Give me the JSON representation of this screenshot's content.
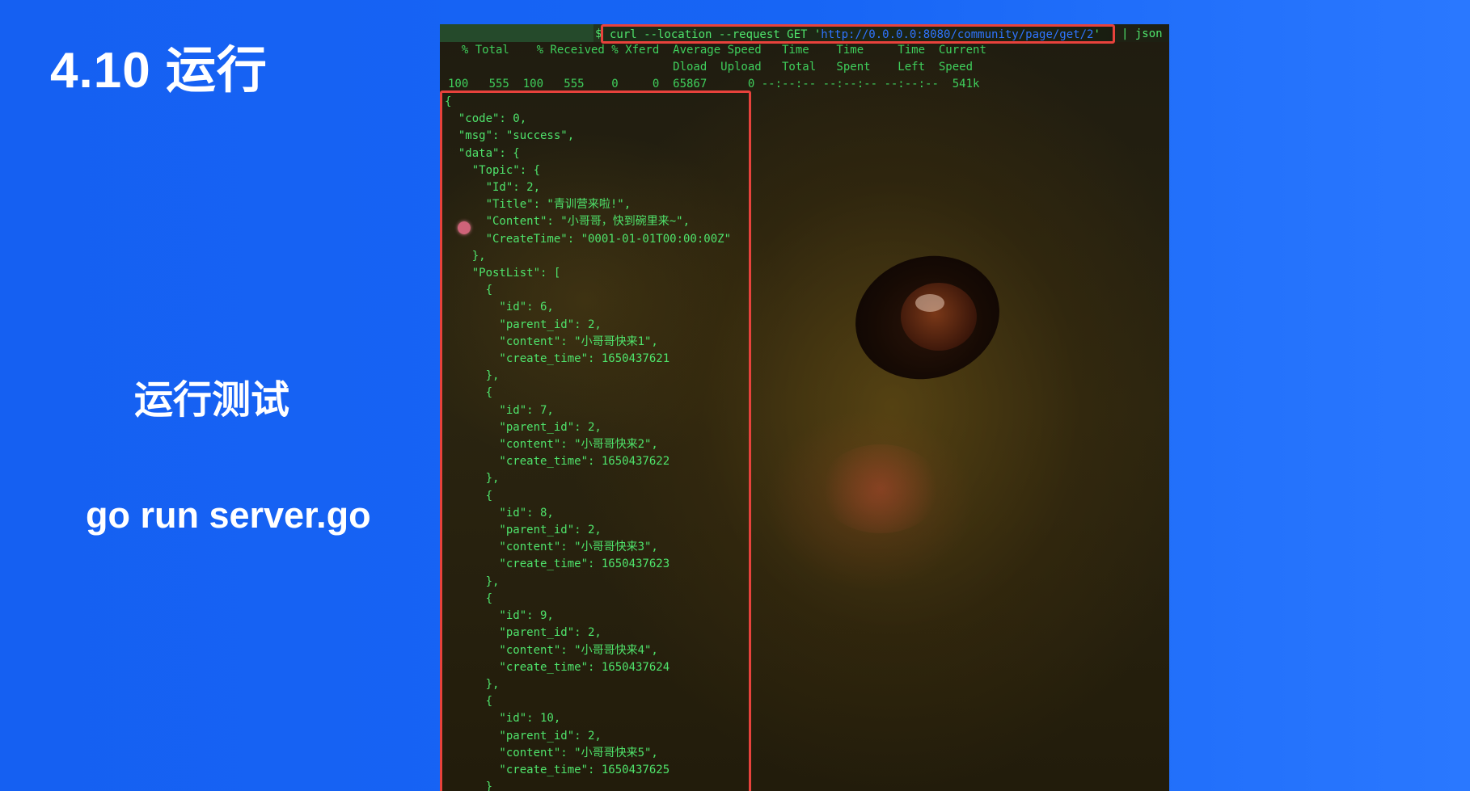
{
  "slide": {
    "title": "4.10 运行",
    "subtitle": "运行测试",
    "command": "go run server.go"
  },
  "terminal": {
    "prompt": "$",
    "command_prefix": "curl --location --request GET '",
    "url": "http://0.0.0.0:8080/community/page/get/2",
    "command_suffix": "'",
    "pipe": "| json",
    "stats_header_1": "  % Total    % Received % Xferd  Average Speed   Time    Time     Time  Current",
    "stats_header_2": "                                 Dload  Upload   Total   Spent    Left  Speed",
    "stats_row": "100   555  100   555    0     0  65867      0 --:--:-- --:--:-- --:--:--  541k",
    "json_output": "{\n  \"code\": 0,\n  \"msg\": \"success\",\n  \"data\": {\n    \"Topic\": {\n      \"Id\": 2,\n      \"Title\": \"青训营来啦!\",\n      \"Content\": \"小哥哥，快到碗里来~\",\n      \"CreateTime\": \"0001-01-01T00:00:00Z\"\n    },\n    \"PostList\": [\n      {\n        \"id\": 6,\n        \"parent_id\": 2,\n        \"content\": \"小哥哥快来1\",\n        \"create_time\": 1650437621\n      },\n      {\n        \"id\": 7,\n        \"parent_id\": 2,\n        \"content\": \"小哥哥快来2\",\n        \"create_time\": 1650437622\n      },\n      {\n        \"id\": 8,\n        \"parent_id\": 2,\n        \"content\": \"小哥哥快来3\",\n        \"create_time\": 1650437623\n      },\n      {\n        \"id\": 9,\n        \"parent_id\": 2,\n        \"content\": \"小哥哥快来4\",\n        \"create_time\": 1650437624\n      },\n      {\n        \"id\": 10,\n        \"parent_id\": 2,\n        \"content\": \"小哥哥快来5\",\n        \"create_time\": 1650437625\n      }"
  },
  "colors": {
    "slide_background": "#1765f5",
    "terminal_text": "#4fe36b",
    "highlight_border": "#e8423c",
    "url_text": "#2f74ff"
  }
}
